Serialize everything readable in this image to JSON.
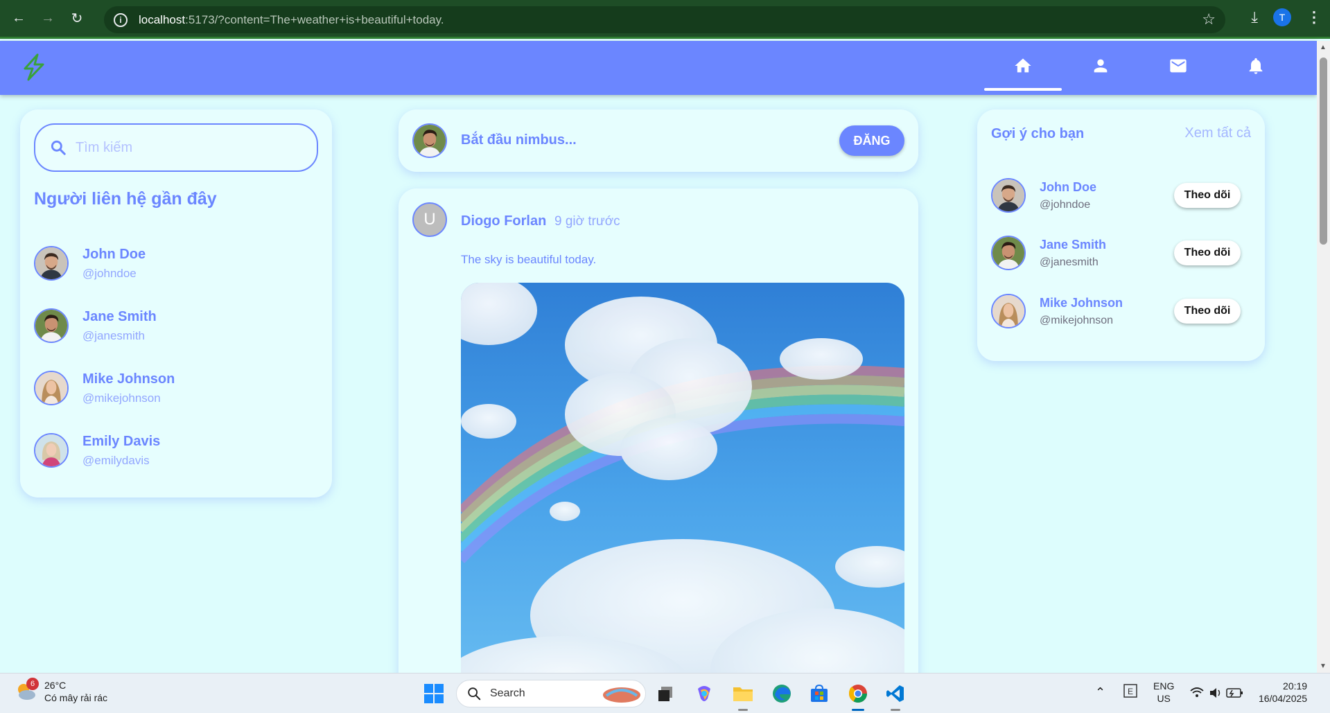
{
  "browser": {
    "url_host": "localhost",
    "url_rest": ":5173/?content=The+weather+is+beautiful+today.",
    "profile_initial": "T"
  },
  "search": {
    "placeholder": "Tìm kiếm"
  },
  "sidebar": {
    "title": "Người liên hệ gần đây",
    "contacts": [
      {
        "name": "John Doe",
        "username": "@johndoe"
      },
      {
        "name": "Jane Smith",
        "username": "@janesmith"
      },
      {
        "name": "Mike Johnson",
        "username": "@mikejohnson"
      },
      {
        "name": "Emily Davis",
        "username": "@emilydavis"
      }
    ]
  },
  "composer": {
    "prompt": "Bắt đầu nimbus...",
    "post_label": "ĐĂNG"
  },
  "post": {
    "avatar_initial": "U",
    "author": "Diogo Forlan",
    "time": "9 giờ trước",
    "content": "The sky is beautiful today."
  },
  "suggestions": {
    "title": "Gợi ý cho bạn",
    "see_all": "Xem tất cả",
    "follow_label": "Theo dõi",
    "items": [
      {
        "name": "John Doe",
        "username": "@johndoe"
      },
      {
        "name": "Jane Smith",
        "username": "@janesmith"
      },
      {
        "name": "Mike Johnson",
        "username": "@mikejohnson"
      }
    ]
  },
  "taskbar": {
    "weather_badge": "6",
    "temperature": "26°C",
    "condition": "Có mây rải rác",
    "search_label": "Search",
    "lang_top": "ENG",
    "lang_bottom": "US",
    "time": "20:19",
    "date": "16/04/2025"
  },
  "colors": {
    "brand": "#6b86ff",
    "background": "#ddfdfd",
    "browser_frame": "#1e4d26"
  }
}
